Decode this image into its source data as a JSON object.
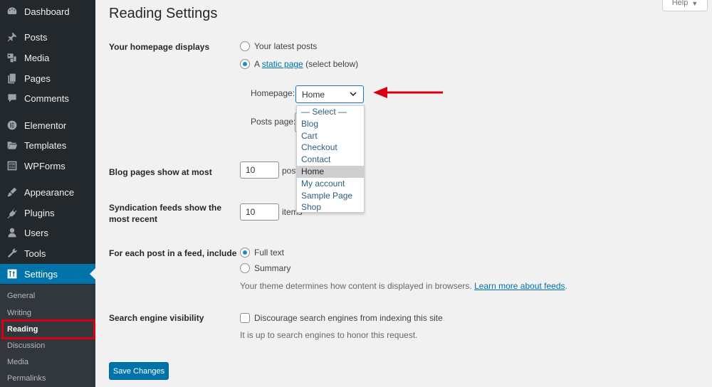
{
  "sidebar": {
    "items": [
      {
        "label": "Dashboard",
        "icon": "dashboard-icon"
      },
      {
        "label": "Posts",
        "icon": "pin-icon"
      },
      {
        "label": "Media",
        "icon": "media-icon"
      },
      {
        "label": "Pages",
        "icon": "pages-icon"
      },
      {
        "label": "Comments",
        "icon": "comment-icon"
      },
      {
        "label": "Elementor",
        "icon": "elementor-icon"
      },
      {
        "label": "Templates",
        "icon": "folder-icon"
      },
      {
        "label": "WPForms",
        "icon": "form-icon"
      },
      {
        "label": "Appearance",
        "icon": "paintbrush-icon"
      },
      {
        "label": "Plugins",
        "icon": "plugin-icon"
      },
      {
        "label": "Users",
        "icon": "user-icon"
      },
      {
        "label": "Tools",
        "icon": "wrench-icon"
      },
      {
        "label": "Settings",
        "icon": "settings-icon",
        "active": true
      }
    ],
    "submenu": [
      "General",
      "Writing",
      "Reading",
      "Discussion",
      "Media",
      "Permalinks"
    ],
    "current_submenu": "Reading"
  },
  "header": {
    "title": "Reading Settings",
    "help_label": "Help"
  },
  "homepage_displays": {
    "label": "Your homepage displays",
    "option_latest": "Your latest posts",
    "option_static_prefix": "A",
    "option_static_link": "static page",
    "option_static_suffix": "(select below)",
    "selected": "static",
    "homepage_label": "Homepage:",
    "homepage_value": "Home",
    "posts_page_label": "Posts page:",
    "dropdown_options": [
      "— Select —",
      "Blog",
      "Cart",
      "Checkout",
      "Contact",
      "Home",
      "My account",
      "Sample Page",
      "Shop"
    ],
    "dropdown_highlighted": "Home"
  },
  "blog_pages": {
    "label": "Blog pages show at most",
    "value": "10",
    "suffix": "posts"
  },
  "syndication": {
    "label": "Syndication feeds show the most recent",
    "value": "10",
    "suffix": "items"
  },
  "feed_include": {
    "label": "For each post in a feed, include",
    "option_full": "Full text",
    "option_summary": "Summary",
    "selected": "full",
    "desc_text": "Your theme determines how content is displayed in browsers.",
    "desc_link": "Learn more about feeds"
  },
  "search_visibility": {
    "label": "Search engine visibility",
    "checkbox_label": "Discourage search engines from indexing this site",
    "checked": false,
    "desc": "It is up to search engines to honor this request."
  },
  "save_label": "Save Changes",
  "colors": {
    "sidebar_bg": "#23282d",
    "submenu_bg": "#32373c",
    "accent": "#0073aa",
    "highlight_red": "#d80012"
  }
}
